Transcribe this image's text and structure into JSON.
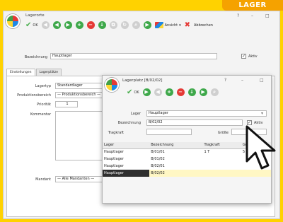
{
  "corner_tag": "LAGER",
  "main_window": {
    "title": "Lagerorte",
    "controls": [
      "?",
      "–",
      "□"
    ],
    "toolbar": {
      "ok_label": "OK",
      "ansicht_label": "Ansicht",
      "close_label": "Abbrechen"
    },
    "bezeichnung": {
      "label": "Bezeichnung",
      "value": "Hauptlager",
      "aktiv_label": "Aktiv",
      "aktiv_checked": true
    },
    "tabs": [
      "Einstellungen",
      "Lagerplätze"
    ],
    "fields": {
      "lagertyp": {
        "label": "Lagertyp",
        "value": "Standardlager"
      },
      "produktionsbereich": {
        "label": "Produktionsbereich",
        "value": "— Produktionsbereich —"
      },
      "prioritaet": {
        "label": "Priorität",
        "value": "1"
      },
      "kommentar": {
        "label": "Kommentar"
      },
      "mandant": {
        "label": "Mandant",
        "value": "— Alle Mandanten —"
      }
    }
  },
  "sub_window": {
    "title": "Lagerplatz [B/02/02]",
    "controls": [
      "?",
      "–",
      "□"
    ],
    "toolbar": {
      "ok_label": "OK"
    },
    "fields": {
      "lager": {
        "label": "Lager",
        "value": "Hauptlager"
      },
      "bezeichnung": {
        "label": "Bezeichnung",
        "value": "B/02/02"
      },
      "aktiv_label": "Aktiv",
      "aktiv_checked": true,
      "tragkraft": {
        "label": "Tragkraft",
        "value": ""
      },
      "groesse": {
        "label": "Größe",
        "value": ""
      }
    },
    "table": {
      "columns": [
        "Lager",
        "Bezeichnung",
        "Tragkraft",
        "Grösse"
      ],
      "rows": [
        [
          "Hauptlager",
          "B/01/01",
          "1 T",
          "5 m²"
        ],
        [
          "Hauptlager",
          "B/01/02",
          "",
          ""
        ],
        [
          "Hauptlager",
          "B/02/01",
          "",
          ""
        ],
        [
          "Hauptlager",
          "B/02/02",
          "",
          ""
        ]
      ],
      "selected_row": 3
    }
  },
  "icons": {
    "app_logo": "app-logo-icon",
    "ok": "checkmark-icon",
    "nav": [
      "first-icon",
      "prev-icon",
      "next-icon",
      "last-icon"
    ],
    "delete": "minus-icon",
    "close": "close-x-icon",
    "cursor": "mouse-pointer-icon"
  }
}
